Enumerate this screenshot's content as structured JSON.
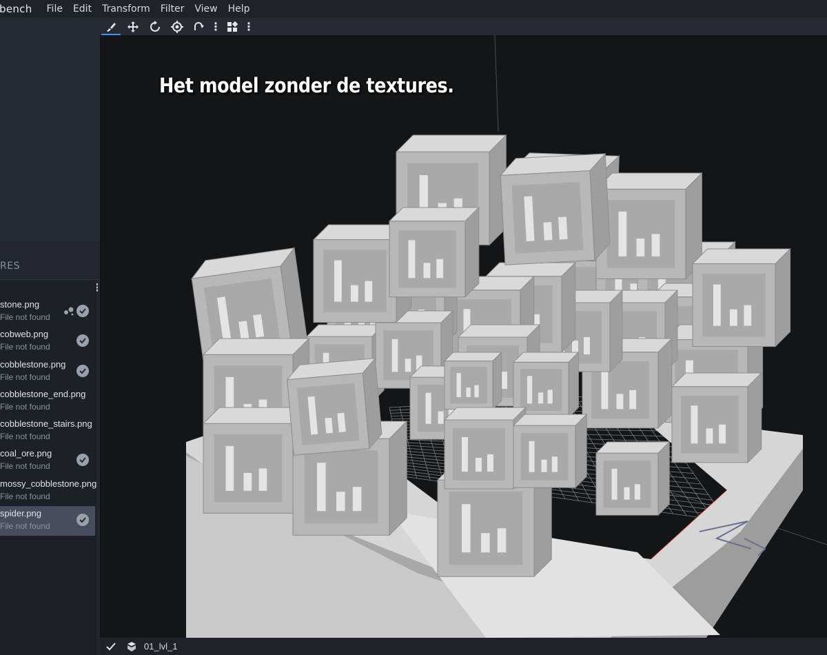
{
  "app": {
    "title": "bench"
  },
  "menu": [
    "File",
    "Edit",
    "Transform",
    "Filter",
    "View",
    "Help"
  ],
  "toolbar": {
    "tools": [
      "brush-icon",
      "move-icon",
      "rotate-icon",
      "pivot-icon",
      "resize-icon",
      "more-icon",
      "layout-icon",
      "more-icon"
    ]
  },
  "sidebar": {
    "panel_title": "RES",
    "textures": [
      {
        "name": "stone.png",
        "status": "File not found",
        "particle": true,
        "checked": true,
        "selected": false
      },
      {
        "name": "cobweb.png",
        "status": "File not found",
        "particle": false,
        "checked": true,
        "selected": false
      },
      {
        "name": "cobblestone.png",
        "status": "File not found",
        "particle": false,
        "checked": true,
        "selected": false
      },
      {
        "name": "cobblestone_end.png",
        "status": "File not found",
        "particle": false,
        "checked": false,
        "selected": false
      },
      {
        "name": "cobblestone_stairs.png",
        "status": "File not found",
        "particle": false,
        "checked": false,
        "selected": false
      },
      {
        "name": "coal_ore.png",
        "status": "File not found",
        "particle": false,
        "checked": true,
        "selected": false
      },
      {
        "name": "mossy_cobblestone.png",
        "status": "File not found",
        "particle": false,
        "checked": false,
        "selected": false
      },
      {
        "name": "spider.png",
        "status": "File not found",
        "particle": false,
        "checked": true,
        "selected": true
      }
    ]
  },
  "viewport": {
    "caption": "Het model zonder de textures.",
    "background_color": "#141517",
    "block_color": "#b9b9b9"
  },
  "statusbar": {
    "model_name": "01_lvl_1"
  }
}
